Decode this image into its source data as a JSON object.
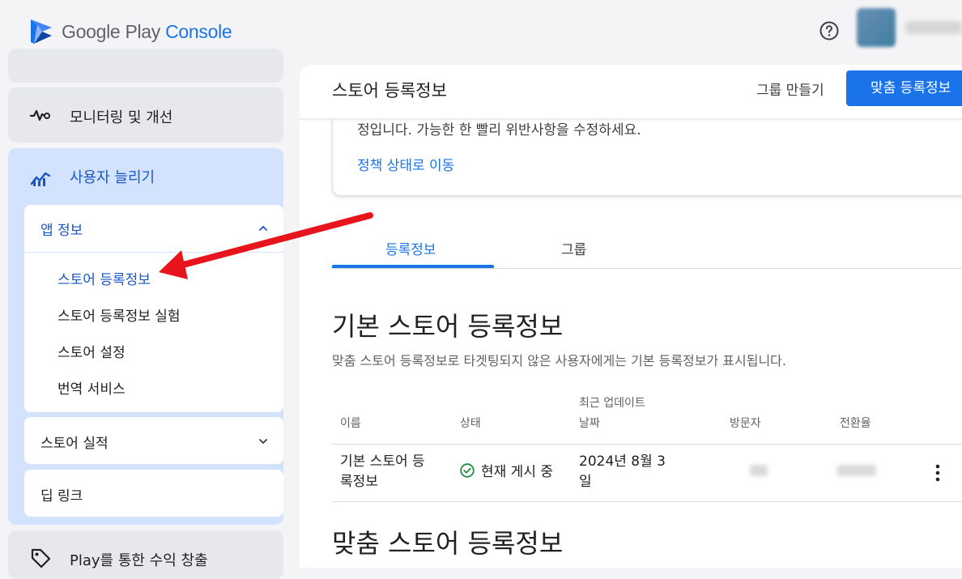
{
  "header": {
    "logo_primary": "Google Play",
    "logo_secondary": "Console",
    "help_icon": "help-circle-icon"
  },
  "sidebar": {
    "monitoring": {
      "label": "모니터링 및 개선",
      "icon": "vitals-icon"
    },
    "grow": {
      "label": "사용자 늘리기",
      "icon": "growth-chart-icon"
    },
    "app_info": {
      "label": "앱 정보",
      "items": [
        "스토어 등록정보",
        "스토어 등록정보 실험",
        "스토어 설정",
        "번역 서비스"
      ]
    },
    "store_performance": {
      "label": "스토어 실적"
    },
    "deep_links": {
      "label": "딥 링크"
    },
    "monetize": {
      "label": "Play를 통한 수익 창출",
      "icon": "tag-icon"
    }
  },
  "main": {
    "page_title": "스토어 등록정보",
    "create_group_label": "그룹 만들기",
    "custom_listing_button": "맞춤 등록정보",
    "notice": {
      "text": "정입니다. 가능한 한 빨리 위반사항을 수정하세요.",
      "link": "정책 상태로 이동"
    },
    "tabs": [
      "등록정보",
      "그룹"
    ],
    "default_section": {
      "title": "기본 스토어 등록정보",
      "description": "맞춤 스토어 등록정보로 타겟팅되지 않은 사용자에게는 기본 등록정보가 표시됩니다."
    },
    "table": {
      "headers": {
        "name": "이름",
        "status": "상태",
        "updated_line1": "최근 업데이트",
        "updated_line2": "날짜",
        "visitors": "방문자",
        "conversion": "전환율"
      },
      "rows": [
        {
          "name_line1": "기본 스토어 등",
          "name_line2": "록정보",
          "status": "현재 게시 중",
          "date_line1": "2024년 8월 3",
          "date_line2": "일"
        }
      ]
    },
    "custom_section_title": "맞춤 스토어 등록정보"
  },
  "colors": {
    "accent": "#1a73e8",
    "active_nav": "#d3e3fd",
    "annotation_arrow": "#e8141b",
    "status_ok": "#1e8e3e"
  }
}
